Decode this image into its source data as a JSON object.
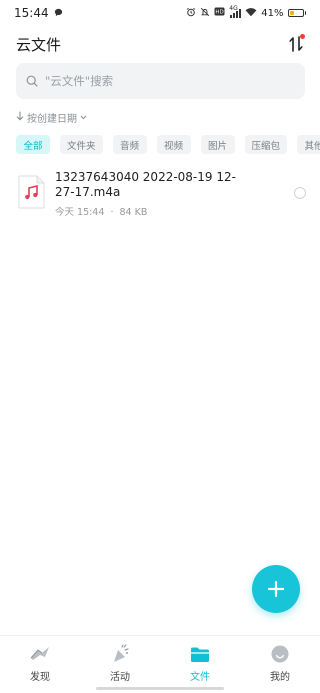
{
  "status_bar": {
    "time": "15:44",
    "battery_text": "41%",
    "battery_level": 0.41,
    "network_label": "4G",
    "icons": [
      "chat-bubble-icon",
      "alarm-icon",
      "mute-icon",
      "hd-icon",
      "signal-icon",
      "wifi-icon",
      "battery-icon"
    ]
  },
  "header": {
    "title": "云文件",
    "action_icon": "sort-toggle-icon"
  },
  "search": {
    "placeholder": "\"云文件\"搜索"
  },
  "sort": {
    "label": "按创建日期"
  },
  "filters": {
    "items": [
      "全部",
      "文件夹",
      "音频",
      "视频",
      "图片",
      "压缩包",
      "其他"
    ],
    "active_index": 0
  },
  "files": [
    {
      "name": "13237643040 2022-08-19 12-27-17.m4a",
      "date": "今天 15:44",
      "separator": "·",
      "size": "84 KB",
      "icon": "audio-file-icon"
    }
  ],
  "fab": {
    "icon": "plus-icon"
  },
  "tabs": [
    {
      "label": "发现",
      "icon": "discover-icon"
    },
    {
      "label": "活动",
      "icon": "activity-icon"
    },
    {
      "label": "文件",
      "icon": "folder-icon",
      "active": true
    },
    {
      "label": "我的",
      "icon": "profile-icon"
    }
  ],
  "colors": {
    "accent": "#18c4d8",
    "chip_active_bg": "#d7f6f8",
    "badge": "#ff3b30",
    "battery": "#f5b400",
    "audio_icon": "#e83a5a"
  }
}
